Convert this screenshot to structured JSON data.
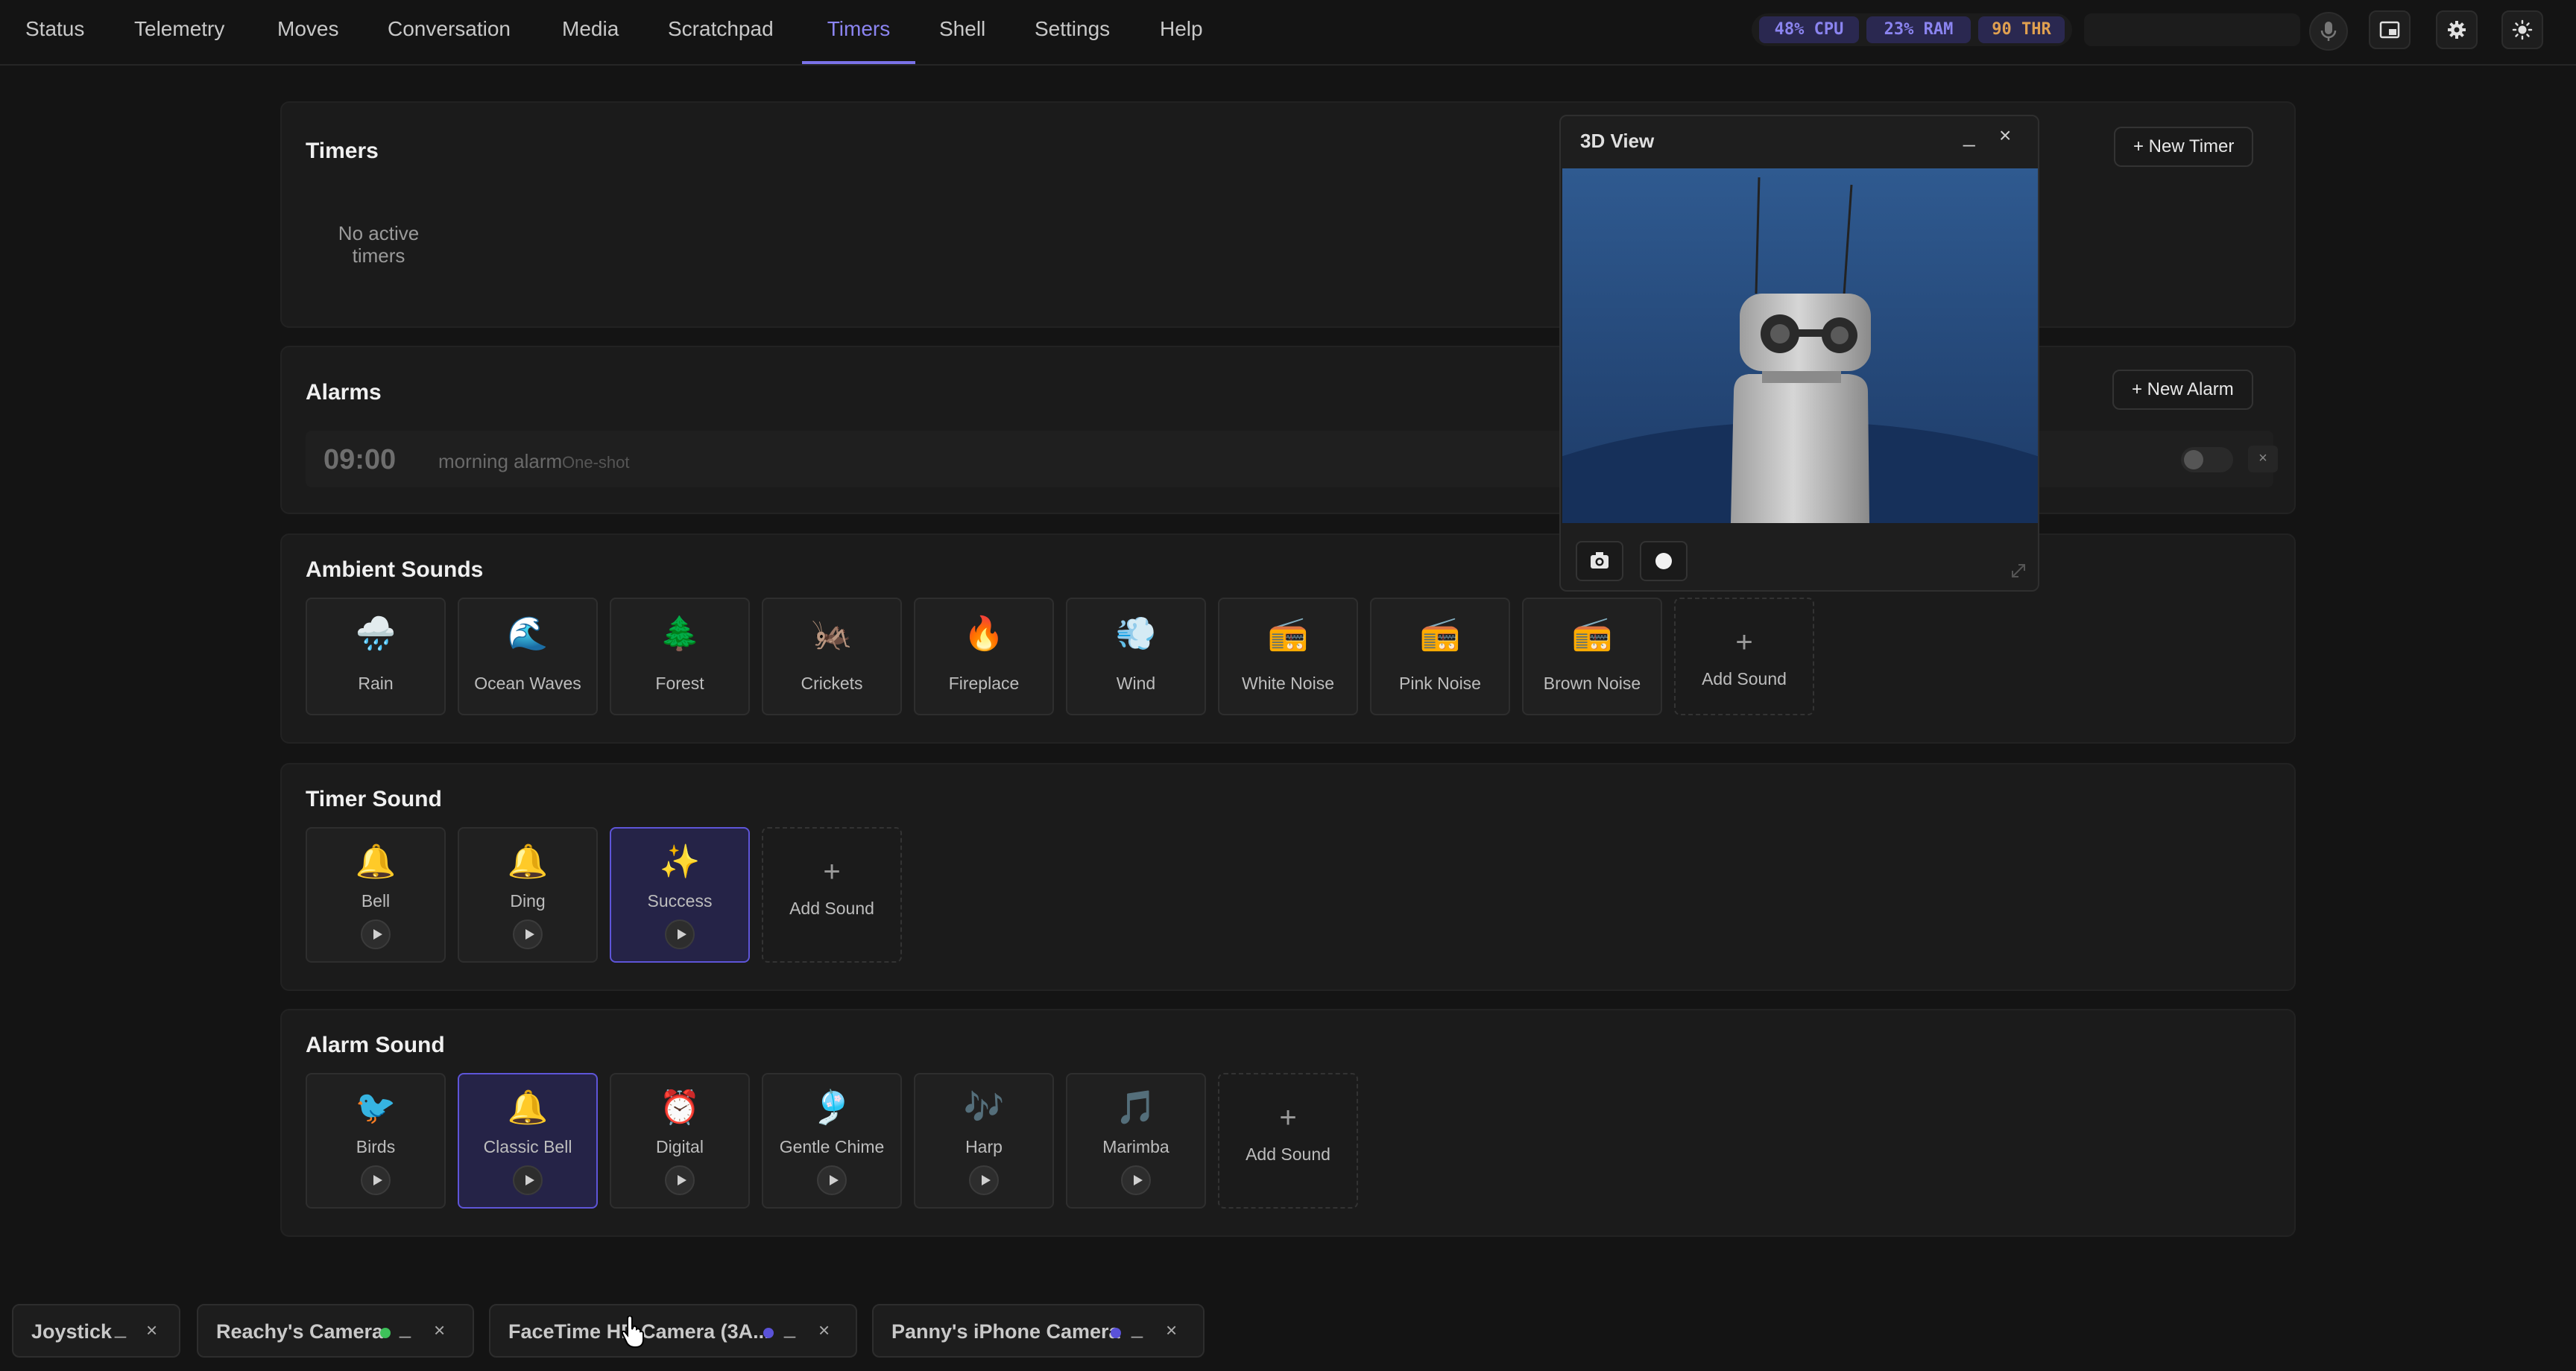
{
  "nav": {
    "tabs": [
      "Status",
      "Telemetry",
      "Moves",
      "Conversation",
      "Media",
      "Scratchpad",
      "Timers",
      "Shell",
      "Settings",
      "Help"
    ],
    "active": "Timers"
  },
  "stats": {
    "cpu": "48% CPU",
    "ram": "23% RAM",
    "thr": "90 THR"
  },
  "search": {
    "placeholder": ""
  },
  "timers": {
    "title": "Timers",
    "new_button": "+ New Timer",
    "empty": "No active timers"
  },
  "alarms": {
    "title": "Alarms",
    "new_button": "+ New Alarm",
    "items": [
      {
        "time": "09:00",
        "label": "morning alarm",
        "type": "One-shot",
        "enabled": false,
        "delete": "×"
      }
    ]
  },
  "ambient": {
    "title": "Ambient Sounds",
    "items": [
      {
        "emoji": "🌧️",
        "label": "Rain"
      },
      {
        "emoji": "🌊",
        "label": "Ocean Waves"
      },
      {
        "emoji": "🌲",
        "label": "Forest"
      },
      {
        "emoji": "🦗",
        "label": "Crickets"
      },
      {
        "emoji": "🔥",
        "label": "Fireplace"
      },
      {
        "emoji": "💨",
        "label": "Wind"
      },
      {
        "emoji": "📻",
        "label": "White Noise"
      },
      {
        "emoji": "📻",
        "label": "Pink Noise"
      },
      {
        "emoji": "📻",
        "label": "Brown Noise"
      }
    ],
    "add": "Add Sound"
  },
  "timer_sound": {
    "title": "Timer Sound",
    "items": [
      {
        "emoji": "🔔",
        "label": "Bell",
        "selected": false
      },
      {
        "emoji": "🔔",
        "label": "Ding",
        "selected": false
      },
      {
        "emoji": "✨",
        "label": "Success",
        "selected": true
      }
    ],
    "add": "Add Sound"
  },
  "alarm_sound": {
    "title": "Alarm Sound",
    "items": [
      {
        "emoji": "🐦",
        "label": "Birds",
        "selected": false
      },
      {
        "emoji": "🔔",
        "label": "Classic Bell",
        "selected": true
      },
      {
        "emoji": "⏰",
        "label": "Digital",
        "selected": false
      },
      {
        "emoji": "🎐",
        "label": "Gentle Chime",
        "selected": false
      },
      {
        "emoji": "🎶",
        "label": "Harp",
        "selected": false
      },
      {
        "emoji": "🎵",
        "label": "Marimba",
        "selected": false
      }
    ],
    "add": "Add Sound"
  },
  "view3d": {
    "title": "3D View",
    "minimize": "_",
    "close": "×"
  },
  "dock": [
    {
      "label": "Joystick",
      "status": null,
      "minimize": "_",
      "close": "×"
    },
    {
      "label": "Reachy's Camera",
      "status": "#3ec15a",
      "minimize": "_",
      "close": "×"
    },
    {
      "label": "FaceTime HD Camera (3A...",
      "status": "#5a52d8",
      "minimize": "_",
      "close": "×"
    },
    {
      "label": "Panny's iPhone Camera",
      "status": "#5a52d8",
      "minimize": "_",
      "close": "×"
    }
  ],
  "colors": {
    "accent": "#7a72e8",
    "background": "#141414",
    "panel": "#1b1b1b"
  }
}
